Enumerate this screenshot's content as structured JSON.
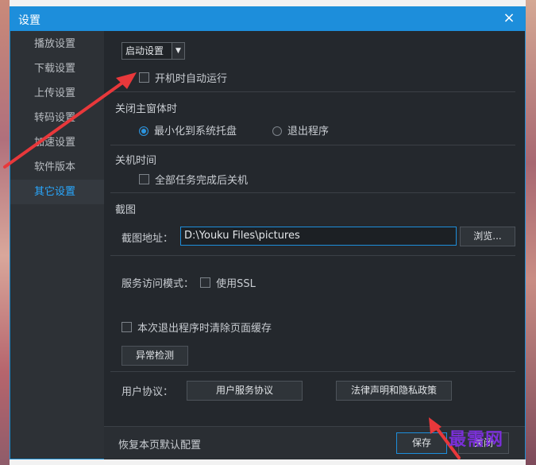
{
  "window": {
    "title": "设置",
    "close_icon": "×"
  },
  "sidebar": {
    "items": [
      {
        "label": "播放设置",
        "active": false
      },
      {
        "label": "下载设置",
        "active": false
      },
      {
        "label": "上传设置",
        "active": false
      },
      {
        "label": "转码设置",
        "active": false
      },
      {
        "label": "加速设置",
        "active": false
      },
      {
        "label": "软件版本",
        "active": false
      },
      {
        "label": "其它设置",
        "active": true
      }
    ]
  },
  "startup": {
    "dropdown_value": "启动设置",
    "autorun_label": "开机时自动运行",
    "autorun_checked": false
  },
  "close_main": {
    "title": "关闭主窗体时",
    "option_minimize": "最小化到系统托盘",
    "option_exit": "退出程序",
    "selected": "最小化到系统托盘"
  },
  "shutdown": {
    "title": "关机时间",
    "label": "全部任务完成后关机",
    "checked": false
  },
  "screenshot": {
    "title": "截图",
    "path_label": "截图地址：",
    "path_value": "D:\\Youku Files\\pictures",
    "browse_label": "浏览..."
  },
  "service": {
    "label": "服务访问模式：",
    "ssl_label": "使用SSL",
    "ssl_checked": false
  },
  "cache": {
    "clear_label": "本次退出程序时清除页面缓存",
    "checked": false,
    "detect_button": "异常检测"
  },
  "agreement": {
    "label": "用户协议：",
    "service_button": "用户服务协议",
    "privacy_button": "法律声明和隐私政策"
  },
  "footer": {
    "restore_label": "恢复本页默认配置",
    "save_button": "保存",
    "cancel_button": "关闭"
  },
  "watermark": "最需网",
  "colors": {
    "accent": "#1d8edb",
    "arrow": "#e8383b",
    "watermark": "#7a2fd8"
  }
}
